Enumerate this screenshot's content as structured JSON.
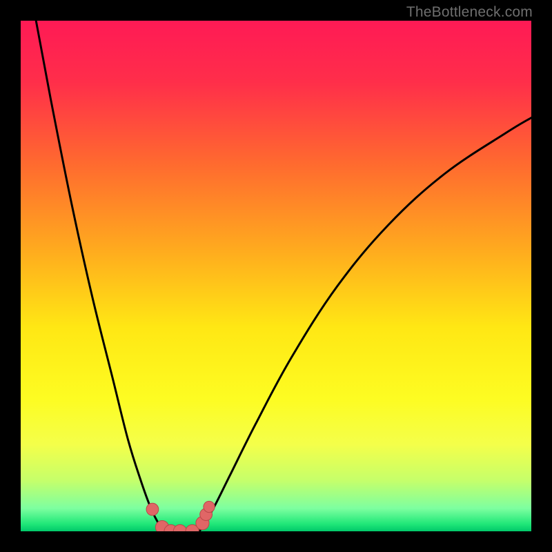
{
  "watermark": "TheBottleneck.com",
  "colors": {
    "frame": "#000000",
    "gradient_stops": [
      {
        "offset": 0.0,
        "color": "#ff1a55"
      },
      {
        "offset": 0.12,
        "color": "#ff2e4a"
      },
      {
        "offset": 0.28,
        "color": "#ff6a2f"
      },
      {
        "offset": 0.45,
        "color": "#ffab1e"
      },
      {
        "offset": 0.6,
        "color": "#ffe714"
      },
      {
        "offset": 0.74,
        "color": "#fdfc22"
      },
      {
        "offset": 0.83,
        "color": "#f4ff4a"
      },
      {
        "offset": 0.9,
        "color": "#c6ff6a"
      },
      {
        "offset": 0.955,
        "color": "#7dffa0"
      },
      {
        "offset": 0.985,
        "color": "#22e879"
      },
      {
        "offset": 1.0,
        "color": "#00c96a"
      }
    ],
    "curve": "#000000",
    "marker_fill": "#e06666",
    "marker_stroke": "#b84848"
  },
  "chart_data": {
    "type": "line",
    "title": "",
    "xlabel": "",
    "ylabel": "",
    "xlim": [
      0,
      100
    ],
    "ylim": [
      0,
      100
    ],
    "series": [
      {
        "name": "left-branch",
        "x": [
          3,
          6,
          10,
          14,
          18,
          21,
          23.5,
          25.5,
          27,
          27.8
        ],
        "values": [
          100,
          84,
          64,
          46,
          30,
          18,
          10,
          4.5,
          1.5,
          0
        ]
      },
      {
        "name": "right-branch",
        "x": [
          35,
          36,
          38,
          41,
          46,
          53,
          62,
          72,
          83,
          95,
          100
        ],
        "values": [
          0,
          1.5,
          5,
          11,
          21,
          34,
          48,
          60,
          70,
          78,
          81
        ]
      },
      {
        "name": "valley-floor",
        "x": [
          27.8,
          30,
          32,
          34,
          35
        ],
        "values": [
          0,
          0,
          0,
          0,
          0
        ]
      }
    ],
    "markers": [
      {
        "x": 25.8,
        "y": 4.3,
        "r": 1.2
      },
      {
        "x": 27.7,
        "y": 0.8,
        "r": 1.3
      },
      {
        "x": 29.4,
        "y": 0.0,
        "r": 1.3
      },
      {
        "x": 31.2,
        "y": 0.0,
        "r": 1.3
      },
      {
        "x": 33.6,
        "y": 0.0,
        "r": 1.3
      },
      {
        "x": 35.6,
        "y": 1.6,
        "r": 1.3
      },
      {
        "x": 36.3,
        "y": 3.3,
        "r": 1.2
      },
      {
        "x": 36.9,
        "y": 4.8,
        "r": 1.1
      }
    ],
    "legend": false,
    "grid": false
  }
}
